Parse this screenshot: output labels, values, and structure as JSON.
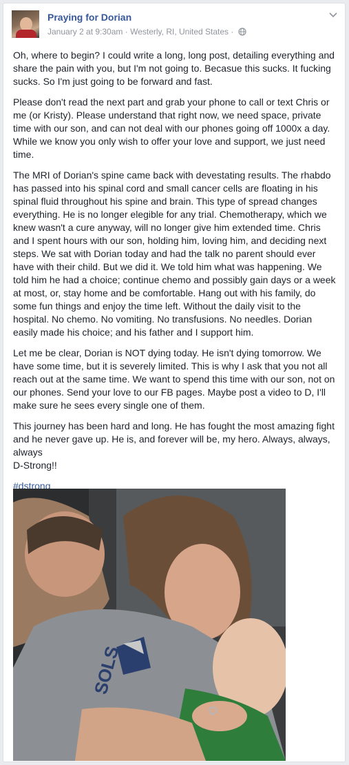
{
  "post": {
    "page_name": "Praying for Dorian",
    "timestamp": "January 2 at 9:30am",
    "separator": "·",
    "location": "Westerly, RI, United States",
    "audience_icon": "globe-icon",
    "options_icon": "chevron-down-icon",
    "paragraphs": [
      "Oh, where to begin? I could write a long, long post, detailing everything and share the pain with you, but I'm not going to. Becasue this sucks. It fucking sucks. So I'm just going to be forward and fast.",
      "Please don't read the next part and grab your phone to call or text Chris or me (or Kristy). Please understand that right now, we need space, private time with our son, and can not deal with our phones going off 1000x a day. While we know you only wish to offer your love and support, we just need time.",
      "The MRI of Dorian's spine came back with devestating results. The rhabdo has passed into his spinal cord and small cancer cells are floating in his spinal fluid throughout his spine and brain. This type of spread changes everything. He is no longer elegible for any trial. Chemotherapy, which we knew wasn't a cure anyway, will no longer give him extended time. Chris and I spent hours with our son, holding him, loving him, and deciding next steps. We sat with Dorian today and had the talk no parent should ever have with their child. But we did it. We told him what was happening. We told him he had a choice; continue chemo and possibly gain days or a week at most, or, stay home and be comfortable. Hang out with his family, do some fun things and enjoy the time left. Without the daily visit to the hospital. No chemo. No vomiting. No transfusions. No needles. Dorian easily made his choice; and his father and I support him.",
      "Let me be clear, Dorian is NOT dying today. He isn't dying tomorrow. We have some time, but it is severely limited. This is why I ask that you not all reach out at the same time. We want to spend this time with our son, not on our phones. Send your love to our FB pages. Maybe post a video to D, I'll make sure he sees every single one of them.",
      "This journey has been hard and long. He has fought the most amazing fight and he never gave up. He is, and forever will be, my hero. Always, always, always",
      "D-Strong!!"
    ],
    "hashtag": "#dstrong",
    "photo_alt": ""
  },
  "colors": {
    "link": "#365899",
    "text": "#1d2129",
    "meta": "#90949c",
    "background": "#e9ebee"
  }
}
